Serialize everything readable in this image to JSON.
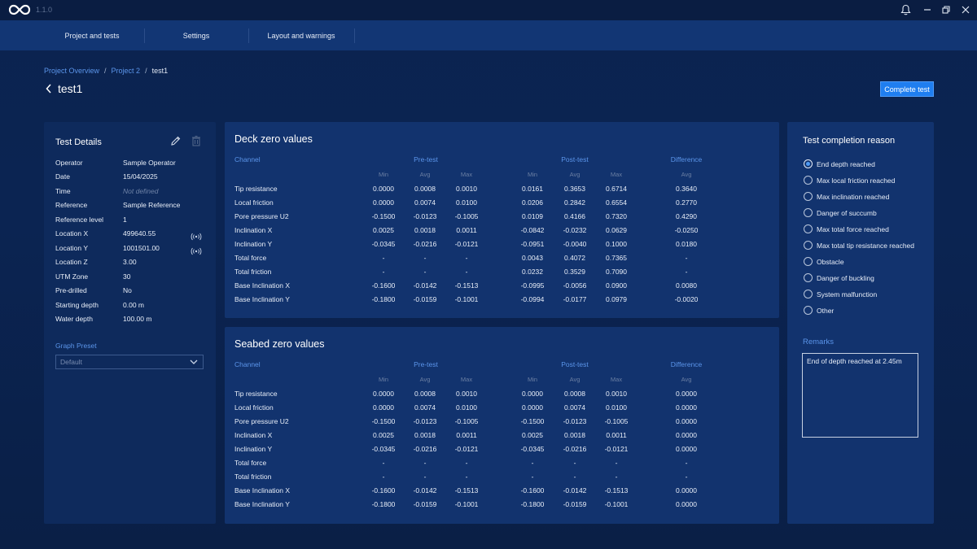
{
  "app": {
    "version": "1.1.0"
  },
  "nav": {
    "items": [
      {
        "label": "Project and tests"
      },
      {
        "label": "Settings"
      },
      {
        "label": "Layout and warnings"
      }
    ]
  },
  "breadcrumb": {
    "items": [
      "Project Overview",
      "Project 2",
      "test1"
    ],
    "separator": "/"
  },
  "page": {
    "title": "test1",
    "complete_button": "Complete test"
  },
  "test_details": {
    "title": "Test Details",
    "rows": [
      {
        "label": "Operator",
        "value": "Sample Operator"
      },
      {
        "label": "Date",
        "value": "15/04/2025"
      },
      {
        "label": "Time",
        "value": "Not defined",
        "muted": true
      },
      {
        "label": "Reference",
        "value": "Sample Reference"
      },
      {
        "label": "Reference level",
        "value": "1"
      },
      {
        "label": "Location X",
        "value": "499640.55",
        "signal": true
      },
      {
        "label": "Location Y",
        "value": "1001501.00",
        "signal": true
      },
      {
        "label": "Location Z",
        "value": "3.00"
      },
      {
        "label": "UTM Zone",
        "value": "30"
      },
      {
        "label": "Pre-drilled",
        "value": "No"
      },
      {
        "label": "Starting depth",
        "value": "0.00 m"
      },
      {
        "label": "Water depth",
        "value": "100.00 m"
      }
    ],
    "graph_preset_label": "Graph Preset",
    "graph_preset_value": "Default"
  },
  "headers": {
    "channel": "Channel",
    "pre": "Pre-test",
    "post": "Post-test",
    "diff": "Difference",
    "min": "Min",
    "avg": "Avg",
    "max": "Max"
  },
  "deck": {
    "title": "Deck zero values",
    "rows": [
      {
        "name": "Tip resistance",
        "v": [
          "0.0000",
          "0.0008",
          "0.0010",
          "0.0161",
          "0.3653",
          "0.6714",
          "0.3640"
        ]
      },
      {
        "name": "Local friction",
        "v": [
          "0.0000",
          "0.0074",
          "0.0100",
          "0.0206",
          "0.2842",
          "0.6554",
          "0.2770"
        ]
      },
      {
        "name": "Pore pressure U2",
        "v": [
          "-0.1500",
          "-0.0123",
          "-0.1005",
          "0.0109",
          "0.4166",
          "0.7320",
          "0.4290"
        ]
      },
      {
        "name": "Inclination X",
        "v": [
          "0.0025",
          "0.0018",
          "0.0011",
          "-0.0842",
          "-0.0232",
          "0.0629",
          "-0.0250"
        ]
      },
      {
        "name": "Inclination Y",
        "v": [
          "-0.0345",
          "-0.0216",
          "-0.0121",
          "-0.0951",
          "-0.0040",
          "0.1000",
          "0.0180"
        ]
      },
      {
        "name": "Total force",
        "v": [
          "-",
          "-",
          "-",
          "0.0043",
          "0.4072",
          "0.7365",
          "-"
        ]
      },
      {
        "name": "Total friction",
        "v": [
          "-",
          "-",
          "-",
          "0.0232",
          "0.3529",
          "0.7090",
          "-"
        ]
      },
      {
        "name": "Base Inclination X",
        "v": [
          "-0.1600",
          "-0.0142",
          "-0.1513",
          "-0.0995",
          "-0.0056",
          "0.0900",
          "0.0080"
        ]
      },
      {
        "name": "Base Inclination Y",
        "v": [
          "-0.1800",
          "-0.0159",
          "-0.1001",
          "-0.0994",
          "-0.0177",
          "0.0979",
          "-0.0020"
        ]
      }
    ]
  },
  "seabed": {
    "title": "Seabed zero values",
    "rows": [
      {
        "name": "Tip resistance",
        "v": [
          "0.0000",
          "0.0008",
          "0.0010",
          "0.0000",
          "0.0008",
          "0.0010",
          "0.0000"
        ]
      },
      {
        "name": "Local friction",
        "v": [
          "0.0000",
          "0.0074",
          "0.0100",
          "0.0000",
          "0.0074",
          "0.0100",
          "0.0000"
        ]
      },
      {
        "name": "Pore pressure U2",
        "v": [
          "-0.1500",
          "-0.0123",
          "-0.1005",
          "-0.1500",
          "-0.0123",
          "-0.1005",
          "0.0000"
        ]
      },
      {
        "name": "Inclination X",
        "v": [
          "0.0025",
          "0.0018",
          "0.0011",
          "0.0025",
          "0.0018",
          "0.0011",
          "0.0000"
        ]
      },
      {
        "name": "Inclination Y",
        "v": [
          "-0.0345",
          "-0.0216",
          "-0.0121",
          "-0.0345",
          "-0.0216",
          "-0.0121",
          "0.0000"
        ]
      },
      {
        "name": "Total force",
        "v": [
          "-",
          "-",
          "-",
          "-",
          "-",
          "-",
          "-"
        ]
      },
      {
        "name": "Total friction",
        "v": [
          "-",
          "-",
          "-",
          "-",
          "-",
          "-",
          "-"
        ]
      },
      {
        "name": "Base Inclination X",
        "v": [
          "-0.1600",
          "-0.0142",
          "-0.1513",
          "-0.1600",
          "-0.0142",
          "-0.1513",
          "0.0000"
        ]
      },
      {
        "name": "Base Inclination Y",
        "v": [
          "-0.1800",
          "-0.0159",
          "-0.1001",
          "-0.1800",
          "-0.0159",
          "-0.1001",
          "0.0000"
        ]
      }
    ]
  },
  "completion": {
    "title": "Test completion reason",
    "options": [
      {
        "label": "End depth reached",
        "selected": true
      },
      {
        "label": "Max local friction reached",
        "selected": false
      },
      {
        "label": "Max inclination reached",
        "selected": false
      },
      {
        "label": "Danger of succumb",
        "selected": false
      },
      {
        "label": "Max total force reached",
        "selected": false
      },
      {
        "label": "Max total tip resistance reached",
        "selected": false
      },
      {
        "label": "Obstacle",
        "selected": false
      },
      {
        "label": "Danger of buckling",
        "selected": false
      },
      {
        "label": "System malfunction",
        "selected": false
      },
      {
        "label": "Other",
        "selected": false
      }
    ],
    "remarks_label": "Remarks",
    "remarks_value": "End of depth reached at 2.45m"
  },
  "icons": {
    "logo": "infinity-logo-icon",
    "bell": "bell-icon",
    "minimize": "minimize-icon",
    "restore": "restore-icon",
    "close": "close-icon",
    "back": "chevron-left-icon",
    "edit": "pencil-icon",
    "delete": "trash-icon",
    "signal": "signal-icon",
    "dropdown": "chevron-down-icon"
  },
  "colors": {
    "accent": "#1f7ef0",
    "link": "#5b95ea",
    "nav": "#123674",
    "panel": "#12336e"
  }
}
